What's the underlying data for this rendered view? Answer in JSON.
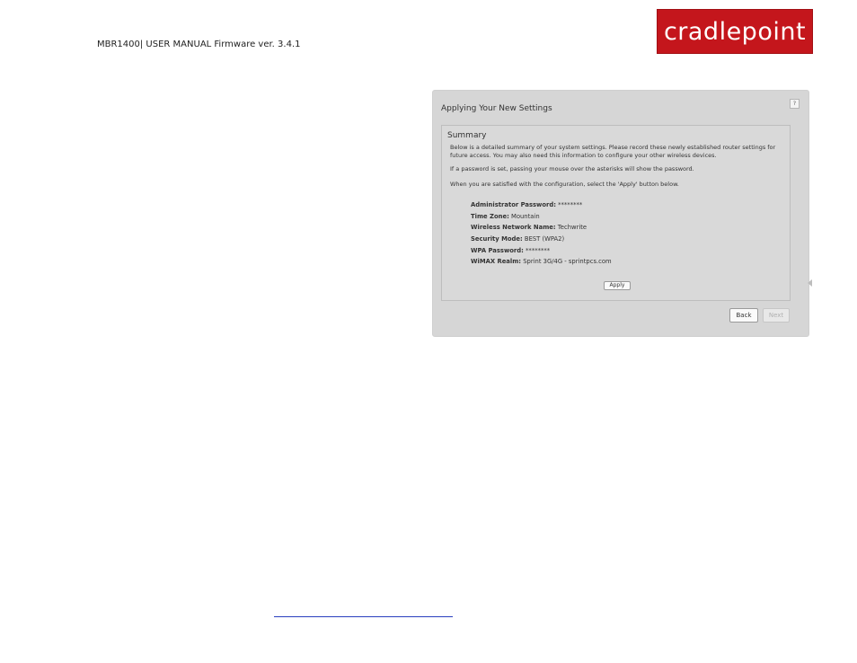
{
  "header": {
    "manual_title": "MBR1400| USER MANUAL Firmware ver. 3.4.1",
    "logo_text": "cradlepoint",
    "logo_color": "#c4161c"
  },
  "panel": {
    "title": "Applying Your New Settings",
    "help_icon": "?",
    "summary": {
      "title": "Summary",
      "paragraphs": [
        "Below is a detailed summary of your system settings. Please record these newly established router settings for future access. You may also need this information to configure your other wireless devices.",
        "If a password is set, passing your mouse over the asterisks will show the password.",
        "When you are satisfied with the configuration, select the 'Apply' button below."
      ],
      "settings": [
        {
          "label": "Administrator Password:",
          "value": "********"
        },
        {
          "label": "Time Zone:",
          "value": "Mountain"
        },
        {
          "label": "Wireless Network Name:",
          "value": "Techwrite"
        },
        {
          "label": "Security Mode:",
          "value": "BEST (WPA2)"
        },
        {
          "label": "WPA Password:",
          "value": "********"
        },
        {
          "label": "WiMAX Realm:",
          "value": "Sprint 3G/4G - sprintpcs.com"
        }
      ],
      "apply_label": "Apply"
    },
    "back_label": "Back",
    "next_label": "Next"
  }
}
